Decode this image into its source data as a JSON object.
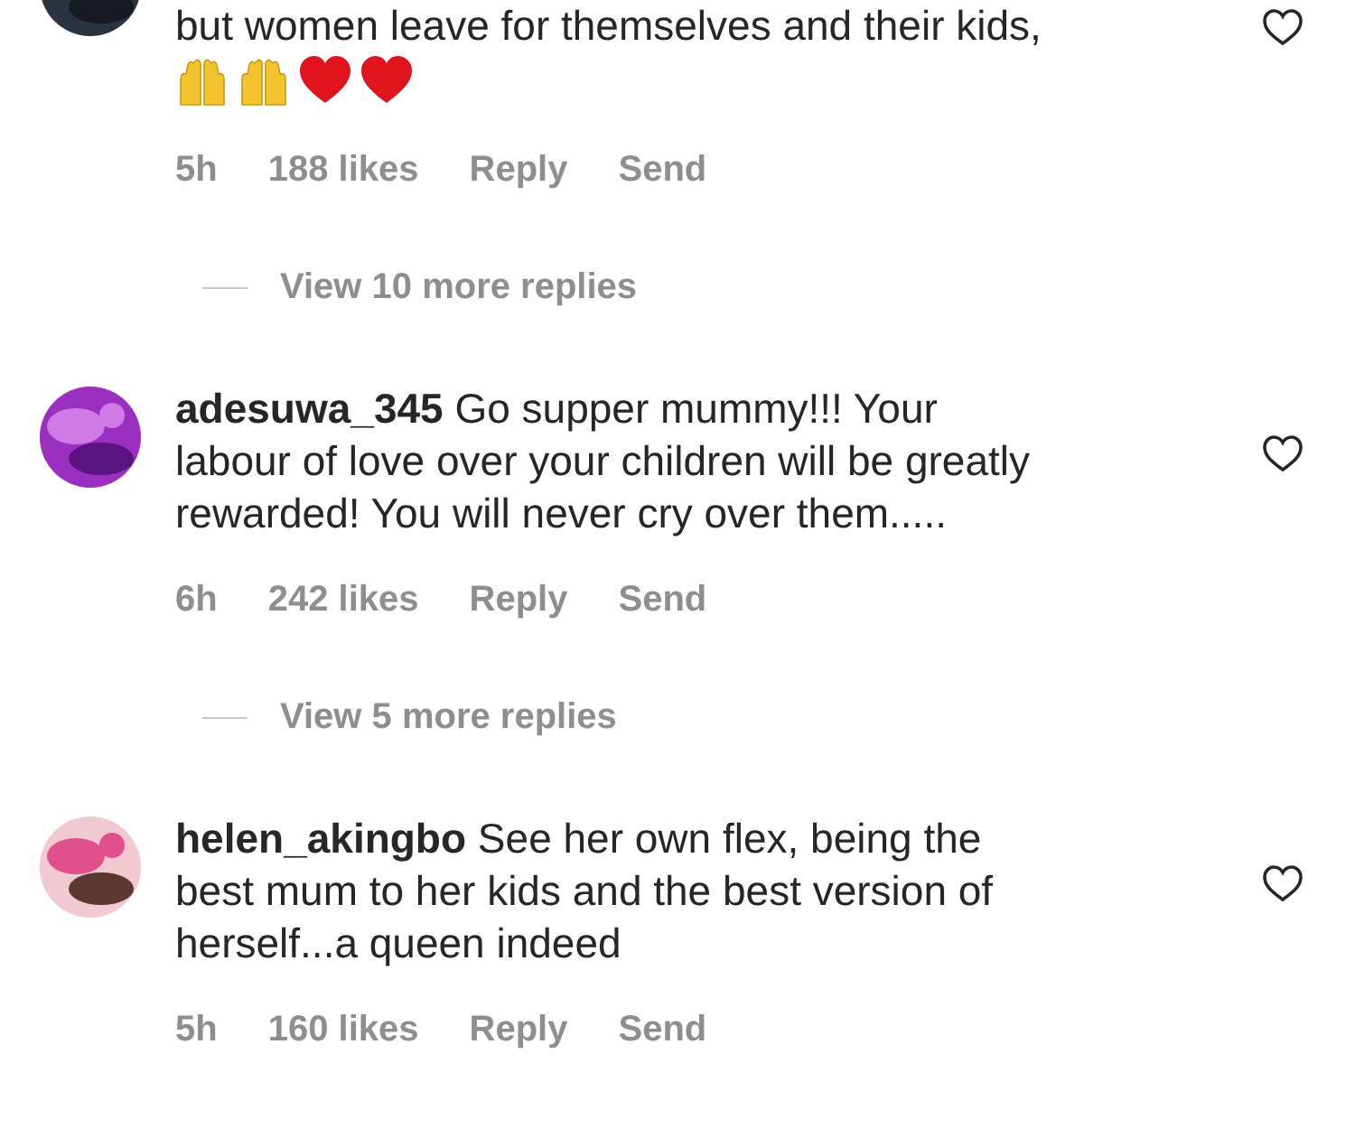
{
  "comments": [
    {
      "avatar": {
        "kind": "picture"
      },
      "lines": [
        "but women leave for themselves and their kids,"
      ],
      "reactions": [
        {
          "kind": "hands"
        },
        {
          "kind": "hands"
        },
        {
          "kind": "heart"
        },
        {
          "kind": "heart"
        }
      ],
      "time": "5h",
      "likes": "188 likes",
      "reply": "Reply",
      "send": "Send",
      "more_replies": "View 10 more replies"
    },
    {
      "avatar": {
        "kind": "picture"
      },
      "lines": [
        "**adesuwa_345** Go supper mummy!!! Your",
        "labour of love over your children will be greatly",
        "rewarded! You will never cry over them....."
      ],
      "time": "6h",
      "likes": "242 likes",
      "reply": "Reply",
      "send": "Send",
      "more_replies": "View 5 more replies"
    },
    {
      "avatar": {
        "kind": "picture"
      },
      "lines": [
        "**helen_akingbo** See her own flex, being the",
        "best mum to her kids and the best version of",
        "herself...a queen indeed"
      ],
      "time": "5h",
      "likes": "160 likes",
      "reply": "Reply",
      "send": "Send"
    }
  ]
}
